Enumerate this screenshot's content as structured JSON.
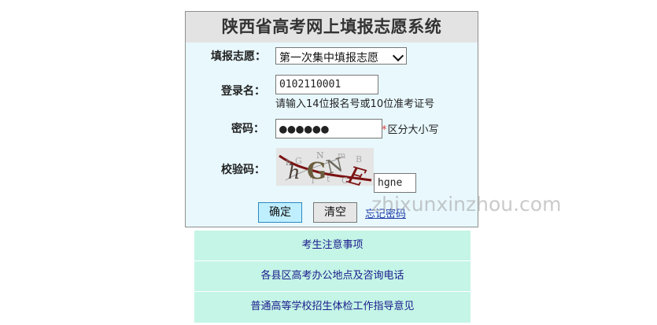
{
  "page": {
    "title": "陕西省高考网上填报志愿系统"
  },
  "form": {
    "volunteer_label": "填报志愿：",
    "volunteer_selected": "第一次集中填报志愿",
    "login_name_label": "登录名：",
    "login_name_value": "0102110001",
    "login_name_hint": "请输入14位报名号或10位准考证号",
    "password_label": "密码：",
    "password_mask": "●●●●●●",
    "required_marker": "*",
    "password_hint": "区分大小写",
    "captcha_label": "校验码：",
    "captcha_value": "hgne",
    "confirm_button": "确定",
    "clear_button": "清空",
    "forgot_password": "忘记密码"
  },
  "captcha_image": {
    "text": "hGNE",
    "noise": "hGm BCTLMNE"
  },
  "links": [
    "考生注意事项",
    "各县区高考办公地点及咨询电话",
    "普通高等学校招生体检工作指导意见"
  ],
  "watermark": "zhixunxinzhou.com",
  "icons": {
    "dropdown": "chevron-down-icon"
  },
  "colors": {
    "panel_background": "#e8f8fd",
    "title_background": "#e3e3e3",
    "link_panel_background": "#c4f5e6",
    "link_color": "#1b1b8d",
    "confirm_background": "#bfefff",
    "required_color": "#e23b3b"
  }
}
